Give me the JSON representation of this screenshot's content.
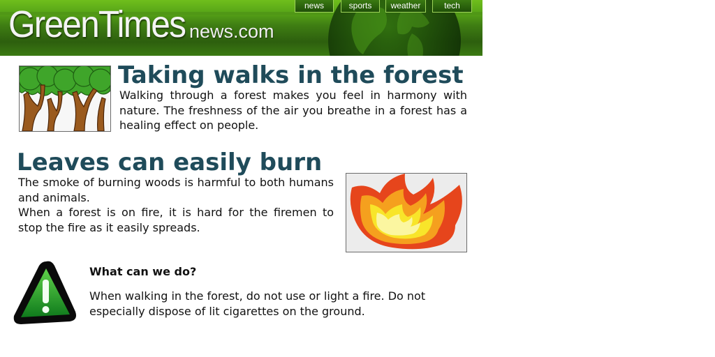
{
  "header": {
    "logo_main": "GreenTimes",
    "logo_sub": "news.com",
    "nav": [
      "news",
      "sports",
      "weather",
      "tech"
    ]
  },
  "articles": [
    {
      "title": "Taking walks in the forest",
      "text": "Walking through a forest makes you feel in harmony with nature. The freshness of the air you breathe in a forest has a healing effect on people."
    },
    {
      "title": "Leaves can easily burn",
      "text_1": "The smoke of burning woods is harmful to both humans and animals.",
      "text_2": "When a forest is on fire, it is hard for the firemen to stop the fire as it easily spreads."
    }
  ],
  "tip": {
    "heading": "What can we do?",
    "text": "When walking in the forest, do not use or light a fire. Do not especially dispose of lit cigarettes on the ground."
  },
  "icons": {
    "forest": "trees-icon",
    "fire": "fire-icon",
    "warning": "warning-icon",
    "globe": "globe-icon"
  },
  "colors": {
    "header_green": "#3f7e13",
    "title_teal": "#1f4b5a"
  }
}
